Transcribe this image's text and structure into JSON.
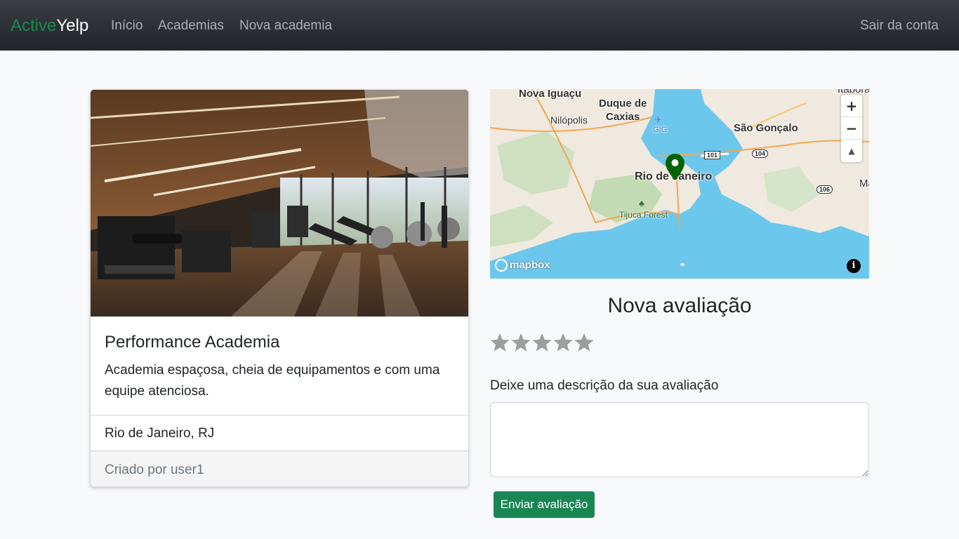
{
  "navbar": {
    "brand_part1": "Active",
    "brand_part2": "Yelp",
    "links": [
      "Início",
      "Academias",
      "Nova academia"
    ],
    "logout": "Sair da conta"
  },
  "gym": {
    "title": "Performance Academia",
    "description": "Academia espaçosa, cheia de equipamentos e com uma equipe atenciosa.",
    "location": "Rio de Janeiro, RJ",
    "created_by": "Criado por user1"
  },
  "map": {
    "labels": {
      "nova_iguacu": "Nova Iguaçu",
      "duque_line1": "Duque de",
      "duque_line2": "Caxias",
      "nilopolis": "Nilópolis",
      "gig": "GIG",
      "sao_goncalo": "São Gonçalo",
      "rio": "Rio de Janeiro",
      "tijuca": "Tijuca Forest",
      "itabora": "Itaboraí",
      "ma": "Ma",
      "r101": "101",
      "r104": "104",
      "r106": "106"
    },
    "zoom_in": "+",
    "zoom_out": "−",
    "compass": "▲",
    "attribution": "mapbox",
    "info": "i",
    "marker_color": "#006400"
  },
  "review": {
    "title": "Nova avaliação",
    "rating": 0,
    "max_rating": 5,
    "description_label": "Deixe uma descrição da sua avaliação",
    "description_value": "",
    "submit": "Enviar avaliação"
  },
  "colors": {
    "brand_green": "#198754",
    "navbar_bg": "#212529",
    "star_empty": "#9e9e9e",
    "water": "#6cc7ec"
  }
}
